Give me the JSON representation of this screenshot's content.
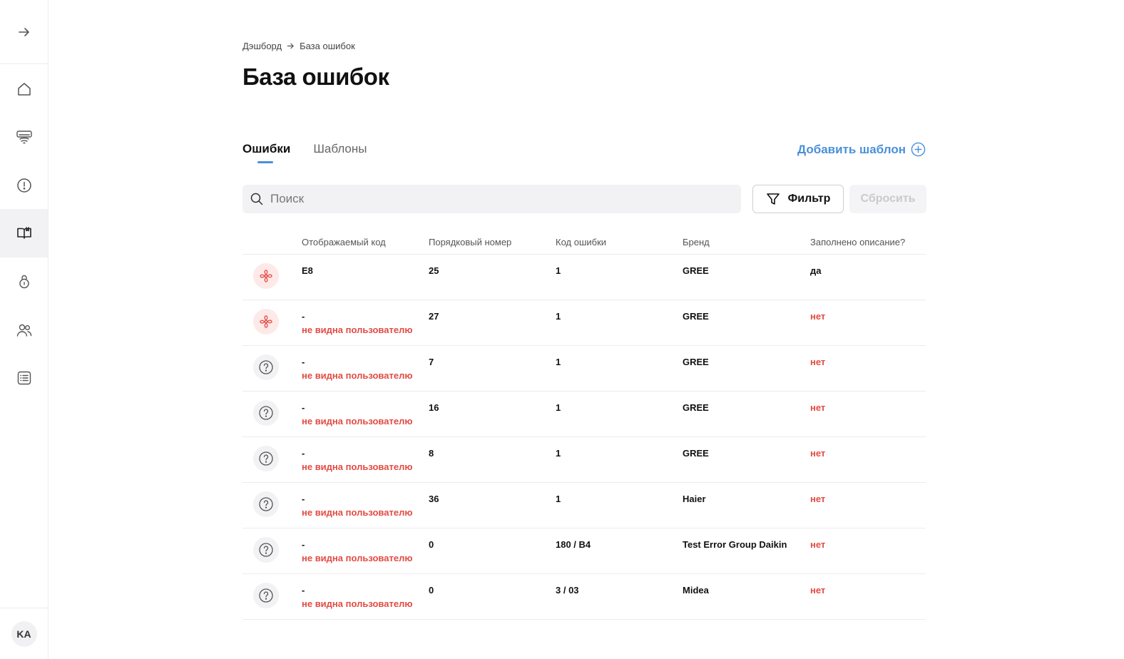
{
  "sidebar": {
    "items": [
      {
        "icon": "arrow-right-icon"
      },
      {
        "icon": "home-icon"
      },
      {
        "icon": "air-conditioner-icon"
      },
      {
        "icon": "alert-circle-icon"
      },
      {
        "icon": "book-icon",
        "active": true
      },
      {
        "icon": "lock-icon"
      },
      {
        "icon": "users-icon"
      },
      {
        "icon": "list-icon"
      }
    ],
    "avatar_initials": "KA"
  },
  "breadcrumb": {
    "items": [
      "Дэшборд",
      "База ошибок"
    ]
  },
  "page_title": "База ошибок",
  "tabs": [
    {
      "label": "Ошибки",
      "active": true
    },
    {
      "label": "Шаблоны",
      "active": false
    }
  ],
  "add_template_label": "Добавить шаблон",
  "search": {
    "placeholder": "Поиск",
    "value": ""
  },
  "filter_label": "Фильтр",
  "reset_label": "Сбросить",
  "table": {
    "columns": [
      "Отображаемый код",
      "Порядковый номер",
      "Код ошибки",
      "Бренд",
      "Заполнено описание?"
    ],
    "rows": [
      {
        "icon": "fan-icon",
        "code": "E8",
        "note": "",
        "number": "25",
        "error_code": "1",
        "brand": "GREE",
        "described": "да"
      },
      {
        "icon": "fan-icon",
        "code": "-",
        "note": "не видна пользователю",
        "number": "27",
        "error_code": "1",
        "brand": "GREE",
        "described": "нет"
      },
      {
        "icon": "question-icon",
        "code": "-",
        "note": "не видна пользователю",
        "number": "7",
        "error_code": "1",
        "brand": "GREE",
        "described": "нет"
      },
      {
        "icon": "question-icon",
        "code": "-",
        "note": "не видна пользователю",
        "number": "16",
        "error_code": "1",
        "brand": "GREE",
        "described": "нет"
      },
      {
        "icon": "question-icon",
        "code": "-",
        "note": "не видна пользователю",
        "number": "8",
        "error_code": "1",
        "brand": "GREE",
        "described": "нет"
      },
      {
        "icon": "question-icon",
        "code": "-",
        "note": "не видна пользователю",
        "number": "36",
        "error_code": "1",
        "brand": "Haier",
        "described": "нет"
      },
      {
        "icon": "question-icon",
        "code": "-",
        "note": "не видна пользователю",
        "number": "0",
        "error_code": "180 / B4",
        "brand": "Test Error Group Daikin",
        "described": "нет"
      },
      {
        "icon": "question-icon",
        "code": "-",
        "note": "не видна пользователю",
        "number": "0",
        "error_code": "3 / 03",
        "brand": "Midea",
        "described": "нет"
      }
    ]
  },
  "colors": {
    "accent": "#4a90d9",
    "negative": "#e24b43",
    "fan_icon_bg": "#fde9e8",
    "neutral_icon_bg": "#f2f2f4"
  }
}
